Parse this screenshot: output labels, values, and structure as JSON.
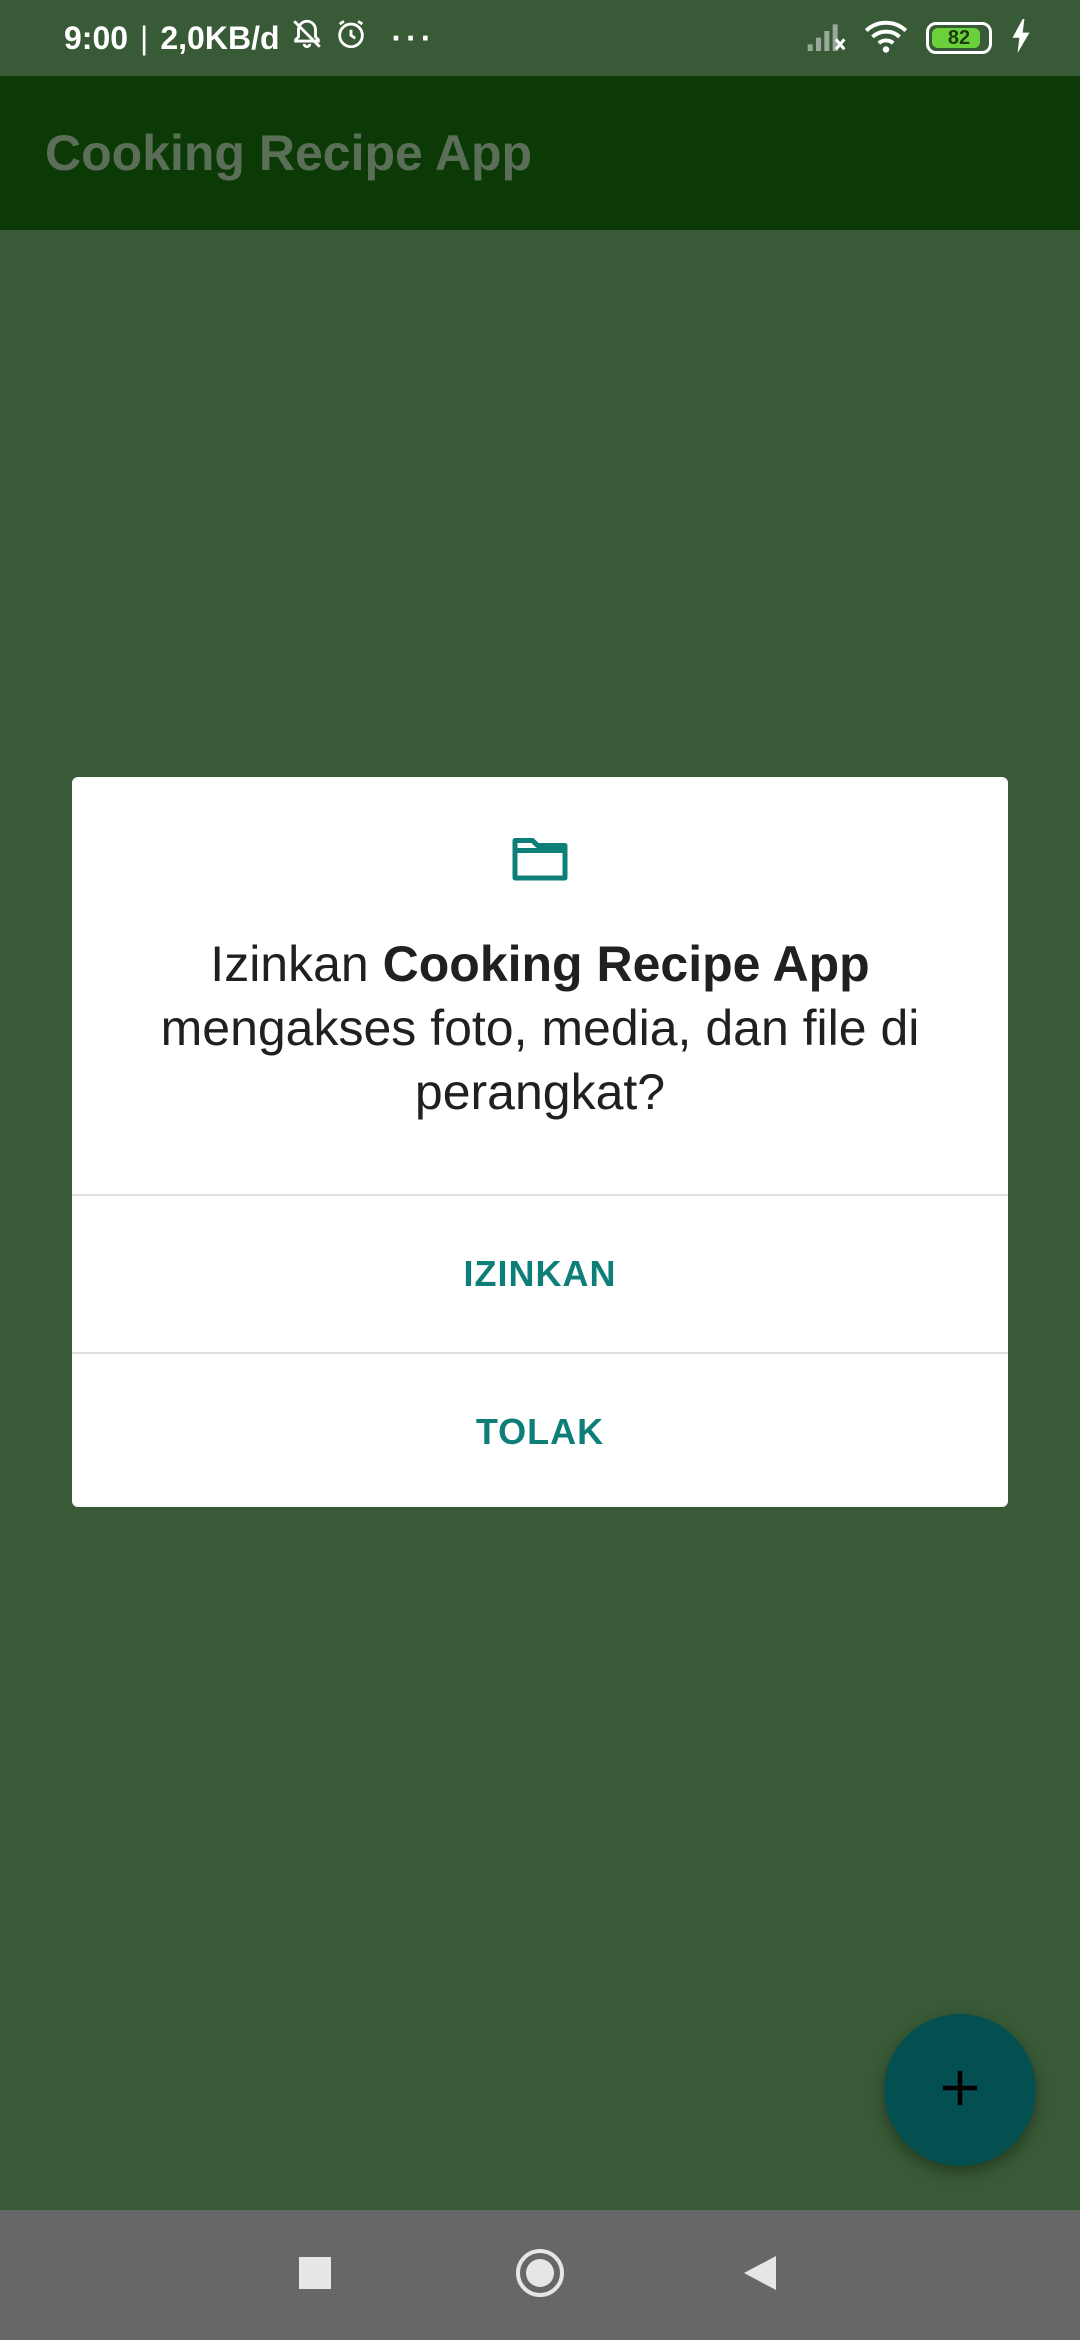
{
  "status_bar": {
    "time": "9:00",
    "separator": "|",
    "network_speed": "2,0KB/d",
    "more_indicator": "···",
    "battery_level": "82",
    "icons": [
      "notifications-off-icon",
      "alarm-icon",
      "cell-signal-off-icon",
      "wifi-icon",
      "battery-icon",
      "charging-icon"
    ]
  },
  "app_bar": {
    "title": "Cooking Recipe App"
  },
  "dialog": {
    "icon": "folder-icon",
    "message_prefix": "Izinkan ",
    "app_name": "Cooking Recipe App",
    "message_suffix": " mengakses foto, media, dan file di perangkat?",
    "allow_label": "IZINKAN",
    "deny_label": "TOLAK"
  },
  "fab": {
    "icon": "plus-icon"
  },
  "nav_bar": {
    "buttons": [
      "recents-square-icon",
      "home-circle-icon",
      "back-triangle-icon"
    ]
  },
  "colors": {
    "app_bar": "#0b3a07",
    "scrim_background": "#385a36",
    "accent": "#0e7f78",
    "fab": "#045050",
    "nav_bar": "#676767"
  }
}
